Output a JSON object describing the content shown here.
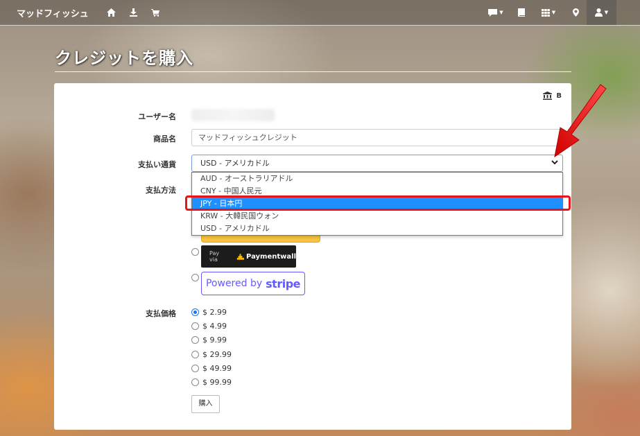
{
  "navbar": {
    "brand": "マッドフィッシュ",
    "icons": [
      "home-icon",
      "download-icon",
      "cart-icon",
      "chat-icon",
      "book-icon",
      "grid-icon",
      "map-marker-icon",
      "user-icon"
    ]
  },
  "page": {
    "title": "クレジットを購入"
  },
  "form": {
    "username_label": "ユーザー名",
    "product_label": "商品名",
    "product_value": "マッドフィッシュクレジット",
    "currency_label": "支払い通貨",
    "currency_selected": "USD - アメリカドル",
    "currency_options": [
      "AUD - オーストラリアドル",
      "CNY - 中国人民元",
      "JPY - 日本円",
      "KRW - 大韓民国ウォン",
      "USD - アメリカドル"
    ],
    "highlighted_option": "JPY - 日本円",
    "method_label": "支払方法",
    "paymentwall_via": "Pay via",
    "paymentwall_name": "Paymentwall",
    "stripe_prefix": "Powered by",
    "stripe_name": "stripe",
    "price_label": "支払価格",
    "prices": [
      "$ 2.99",
      "$ 4.99",
      "$ 9.99",
      "$ 29.99",
      "$ 49.99",
      "$ 99.99"
    ],
    "selected_price": "$ 2.99",
    "buy_button": "購入",
    "top_right_symbol": "B"
  },
  "colors": {
    "accent": "#1e90ff",
    "highlight": "#e8141a",
    "stripe": "#635bff",
    "paypal_yellow": "#f8c440"
  }
}
